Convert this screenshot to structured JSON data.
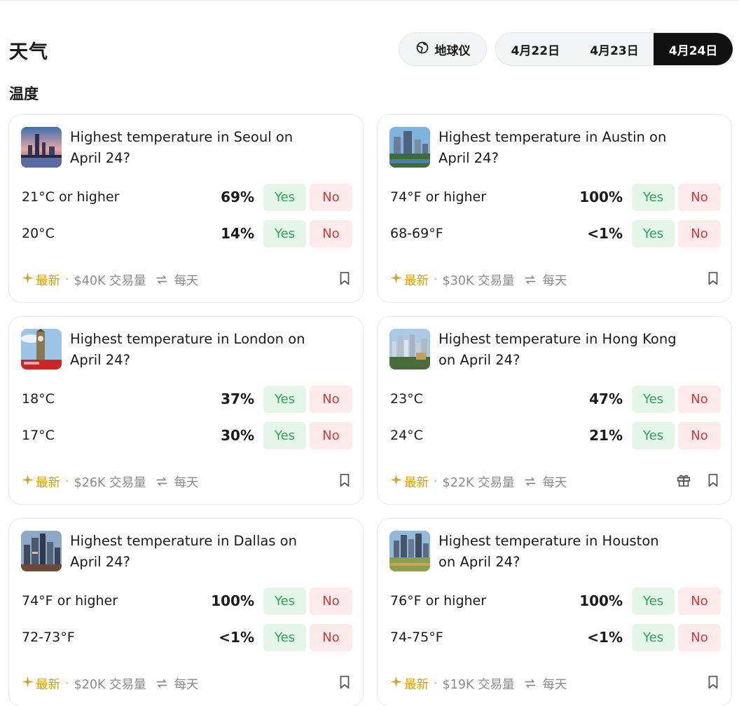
{
  "header": {
    "title": "天气",
    "globe_label": "地球仪",
    "date_tabs": [
      {
        "label": "4月22日",
        "active": false
      },
      {
        "label": "4月23日",
        "active": false
      },
      {
        "label": "4月24日",
        "active": true
      }
    ]
  },
  "section": {
    "title": "温度"
  },
  "colors": {
    "yes": "#2fa357",
    "no": "#d73a3a",
    "new": "#d4a017",
    "active_tab": "#111111"
  },
  "cards": [
    {
      "title": "Highest temperature in Seoul on April 24?",
      "image_icon": "seoul-thumbnail-icon",
      "outcomes": [
        {
          "label": "21°C or higher",
          "pct": "69%",
          "yes": "Yes",
          "no": "No"
        },
        {
          "label": "20°C",
          "pct": "14%",
          "yes": "Yes",
          "no": "No"
        }
      ],
      "footer": {
        "new": "最新",
        "volume": "$40K 交易量",
        "frequency": "每天",
        "has_gift": false
      }
    },
    {
      "title": "Highest temperature in Austin on April 24?",
      "image_icon": "austin-thumbnail-icon",
      "outcomes": [
        {
          "label": "74°F or higher",
          "pct": "100%",
          "yes": "Yes",
          "no": "No"
        },
        {
          "label": "68-69°F",
          "pct": "<1%",
          "yes": "Yes",
          "no": "No"
        }
      ],
      "footer": {
        "new": "最新",
        "volume": "$30K 交易量",
        "frequency": "每天",
        "has_gift": false
      }
    },
    {
      "title": "Highest temperature in London on April 24?",
      "image_icon": "london-thumbnail-icon",
      "outcomes": [
        {
          "label": "18°C",
          "pct": "37%",
          "yes": "Yes",
          "no": "No"
        },
        {
          "label": "17°C",
          "pct": "30%",
          "yes": "Yes",
          "no": "No"
        }
      ],
      "footer": {
        "new": "最新",
        "volume": "$26K 交易量",
        "frequency": "每天",
        "has_gift": false
      }
    },
    {
      "title": "Highest temperature in Hong Kong on April 24?",
      "image_icon": "hong-kong-thumbnail-icon",
      "outcomes": [
        {
          "label": "23°C",
          "pct": "47%",
          "yes": "Yes",
          "no": "No"
        },
        {
          "label": "24°C",
          "pct": "21%",
          "yes": "Yes",
          "no": "No"
        }
      ],
      "footer": {
        "new": "最新",
        "volume": "$22K 交易量",
        "frequency": "每天",
        "has_gift": true
      }
    },
    {
      "title": "Highest temperature in Dallas on April 24?",
      "image_icon": "dallas-thumbnail-icon",
      "outcomes": [
        {
          "label": "74°F or higher",
          "pct": "100%",
          "yes": "Yes",
          "no": "No"
        },
        {
          "label": "72-73°F",
          "pct": "<1%",
          "yes": "Yes",
          "no": "No"
        }
      ],
      "footer": {
        "new": "最新",
        "volume": "$20K 交易量",
        "frequency": "每天",
        "has_gift": false
      }
    },
    {
      "title": "Highest temperature in Houston on April 24?",
      "image_icon": "houston-thumbnail-icon",
      "outcomes": [
        {
          "label": "76°F or higher",
          "pct": "100%",
          "yes": "Yes",
          "no": "No"
        },
        {
          "label": "74-75°F",
          "pct": "<1%",
          "yes": "Yes",
          "no": "No"
        }
      ],
      "footer": {
        "new": "最新",
        "volume": "$19K 交易量",
        "frequency": "每天",
        "has_gift": false
      }
    }
  ]
}
